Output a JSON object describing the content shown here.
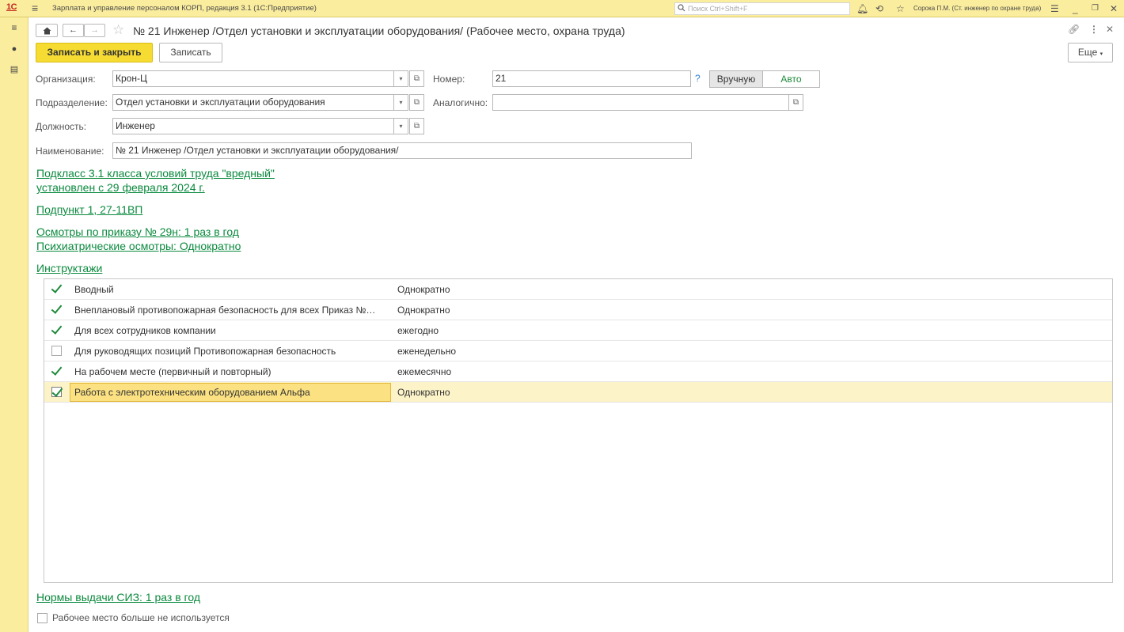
{
  "app": {
    "logo": "1С",
    "title": "Зарплата и управление персоналом КОРП, редакция 3.1  (1С:Предприятие)",
    "search_placeholder": "Поиск Ctrl+Shift+F",
    "user": "Сорока П.М. (Ст. инженер по охране труда)"
  },
  "form": {
    "title": "№ 21 Инженер /Отдел установки и эксплуатации оборудования/ (Рабочее место, охрана труда)",
    "save_close_label": "Записать и закрыть",
    "save_label": "Записать",
    "more_label": "Еще"
  },
  "fields": {
    "organization": {
      "label": "Организация:",
      "value": "Крон-Ц"
    },
    "department": {
      "label": "Подразделение:",
      "value": "Отдел установки и эксплуатации оборудования"
    },
    "position": {
      "label": "Должность:",
      "value": "Инженер"
    },
    "name": {
      "label": "Наименование:",
      "value": "№ 21 Инженер /Отдел установки и эксплуатации оборудования/"
    },
    "number": {
      "label": "Номер:",
      "value": "21",
      "help": "?",
      "manual_label": "Вручную",
      "auto_label": "Авто"
    },
    "similar": {
      "label": "Аналогично:",
      "value": ""
    }
  },
  "links": {
    "class_line1": "Подкласс 3.1 класса условий труда \"вредный\"",
    "class_line2": "установлен с 29 февраля 2024 г.",
    "subclause": "Подпункт 1, 27-11ВП",
    "exams_line1": "Осмотры по приказу № 29н: 1 раз в год",
    "exams_line2": "Психиатрические осмотры: Однократно",
    "briefings": "Инструктажи",
    "ppe": "Нормы выдачи СИЗ: 1 раз в год"
  },
  "briefings": [
    {
      "checked": true,
      "name": "Вводный",
      "frequency": "Однократно"
    },
    {
      "checked": true,
      "name": "Внеплановый противопожарная безопасность для всех Приказ №…",
      "frequency": "Однократно"
    },
    {
      "checked": true,
      "name": "Для всех сотрудников компании",
      "frequency": "ежегодно"
    },
    {
      "checked": false,
      "name": "Для руководящих позиций Противопожарная безопасность",
      "frequency": "еженедельно"
    },
    {
      "checked": true,
      "name": "На рабочем месте (первичный и повторный)",
      "frequency": "ежемесячно"
    },
    {
      "checked": true,
      "name": "Работа с электротехническим оборудованием Альфа",
      "frequency": "Однократно",
      "selected": true
    }
  ],
  "footer": {
    "not_used_label": "Рабочее место больше не используется",
    "not_used_checked": false
  },
  "colors": {
    "accent_yellow": "#f6dc32",
    "panel_yellow": "#fbed9e",
    "link_green": "#0b8a3e",
    "check_green": "#1d8a3a",
    "selected_row": "#fdf3c8"
  }
}
